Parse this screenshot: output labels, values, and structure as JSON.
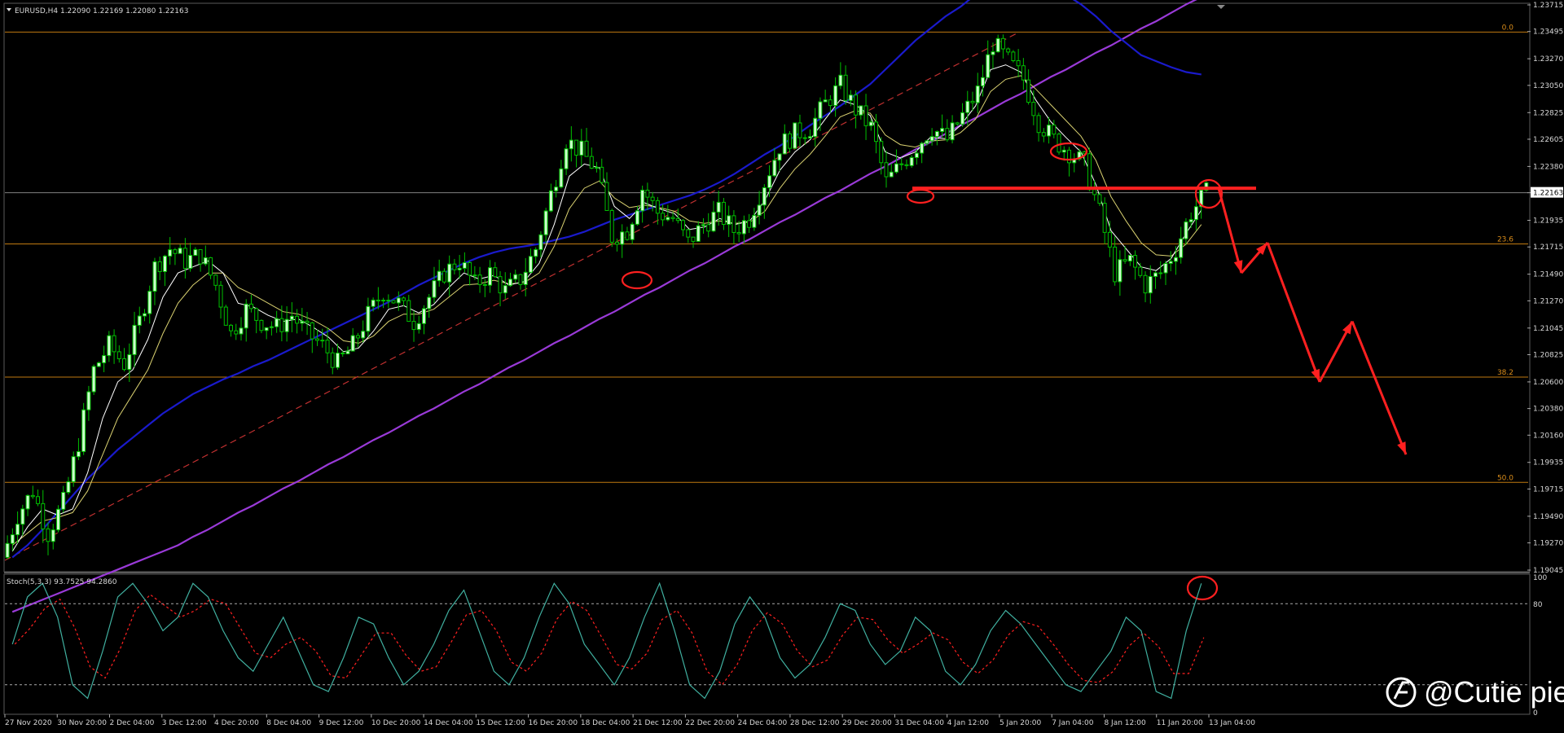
{
  "header": {
    "symbol_line": "EURUSD,H4  1.22090 1.22169 1.22080 1.22163",
    "stoch_line": "Stoch(5,3,3) 93.7525 94.2860"
  },
  "watermark": {
    "text": "@Cutie pie",
    "logo_icon": "logo-icon"
  },
  "colors": {
    "background": "#000000",
    "candle_up_body": "#ccffcc",
    "candle_wick": "#00c000",
    "ma_fast": "#ffffff",
    "ma_slow": "#d8d070",
    "ma_blue": "#1a1acc",
    "ma_purple": "#9a3ad8",
    "fib": "#c07a10",
    "annotation": "#ff2020",
    "stoch_main": "#40b0a0",
    "stoch_signal": "#ff2020"
  },
  "chart_data": [
    {
      "type": "candlestick",
      "symbol": "EURUSD",
      "timeframe": "H4",
      "ylim": [
        1.19045,
        1.23715
      ],
      "y_ticks": [
        "1.23715",
        "1.23495",
        "1.23270",
        "1.23050",
        "1.22825",
        "1.22605",
        "1.22380",
        "1.22163",
        "1.21935",
        "1.21715",
        "1.21490",
        "1.21270",
        "1.21045",
        "1.20825",
        "1.20600",
        "1.20380",
        "1.20160",
        "1.19935",
        "1.19715",
        "1.19490",
        "1.19270",
        "1.19045"
      ],
      "current_price": "1.22163",
      "x_ticks": [
        "27 Nov 2020",
        "30 Nov 20:00",
        "2 Dec 04:00",
        "3 Dec 12:00",
        "4 Dec 20:00",
        "8 Dec 04:00",
        "9 Dec 12:00",
        "10 Dec 20:00",
        "14 Dec 04:00",
        "15 Dec 12:00",
        "16 Dec 20:00",
        "18 Dec 04:00",
        "21 Dec 12:00",
        "22 Dec 20:00",
        "24 Dec 04:00",
        "28 Dec 12:00",
        "29 Dec 20:00",
        "31 Dec 04:00",
        "4 Jan 12:00",
        "5 Jan 20:00",
        "7 Jan 04:00",
        "8 Jan 12:00",
        "11 Jan 20:00",
        "13 Jan 04:00"
      ],
      "fib_levels": [
        {
          "label": "0.0",
          "price": 1.2349
        },
        {
          "label": "23.6",
          "price": 1.2174
        },
        {
          "label": "38.2",
          "price": 1.2064
        },
        {
          "label": "50.0",
          "price": 1.1977
        }
      ],
      "price_path": [
        1.1915,
        1.195,
        1.197,
        1.1935,
        1.196,
        1.201,
        1.207,
        1.209,
        1.2075,
        1.211,
        1.2155,
        1.217,
        1.216,
        1.2165,
        1.214,
        1.21,
        1.212,
        1.211,
        1.2105,
        1.2115,
        1.21,
        1.209,
        1.2075,
        1.209,
        1.2115,
        1.2135,
        1.2125,
        1.211,
        1.213,
        1.215,
        1.216,
        1.214,
        1.215,
        1.2135,
        1.2145,
        1.217,
        1.2215,
        1.226,
        1.225,
        1.2235,
        1.218,
        1.2185,
        1.222,
        1.22,
        1.2195,
        1.2175,
        1.219,
        1.22,
        1.2185,
        1.2195,
        1.2225,
        1.2255,
        1.2265,
        1.227,
        1.229,
        1.2305,
        1.2285,
        1.227,
        1.2225,
        1.224,
        1.2255,
        1.227,
        1.226,
        1.228,
        1.23,
        1.234,
        1.2325,
        1.231,
        1.2275,
        1.226,
        1.225,
        1.224,
        1.22,
        1.215,
        1.216,
        1.214,
        1.215,
        1.217,
        1.22,
        1.2216
      ],
      "ma_fast": [
        1.192,
        1.194,
        1.1955,
        1.195,
        1.1955,
        1.1985,
        1.203,
        1.206,
        1.207,
        1.2095,
        1.213,
        1.215,
        1.2155,
        1.216,
        1.215,
        1.2125,
        1.2122,
        1.2115,
        1.211,
        1.2112,
        1.2105,
        1.2097,
        1.2085,
        1.2088,
        1.2102,
        1.212,
        1.2123,
        1.2117,
        1.2124,
        1.2138,
        1.215,
        1.2145,
        1.2148,
        1.214,
        1.2143,
        1.2158,
        1.219,
        1.223,
        1.224,
        1.2237,
        1.2205,
        1.2195,
        1.2208,
        1.2203,
        1.2199,
        1.2186,
        1.2188,
        1.2195,
        1.219,
        1.2193,
        1.221,
        1.2235,
        1.225,
        1.226,
        1.2277,
        1.2293,
        1.2289,
        1.228,
        1.225,
        1.2245,
        1.225,
        1.2262,
        1.2261,
        1.2272,
        1.2288,
        1.2318,
        1.2322,
        1.2316,
        1.2293,
        1.2275,
        1.2262,
        1.225,
        1.2223,
        1.2185,
        1.217,
        1.2155,
        1.2152,
        1.2162,
        1.2183,
        1.2202
      ],
      "ma_slow": [
        1.1925,
        1.1935,
        1.1945,
        1.1948,
        1.1952,
        1.197,
        1.2,
        1.203,
        1.205,
        1.207,
        1.21,
        1.2125,
        1.214,
        1.215,
        1.215,
        1.2138,
        1.2132,
        1.2125,
        1.2118,
        1.2116,
        1.2111,
        1.2104,
        1.2094,
        1.2092,
        1.2098,
        1.211,
        1.2116,
        1.2116,
        1.212,
        1.213,
        1.214,
        1.2141,
        1.2144,
        1.2141,
        1.2142,
        1.215,
        1.2172,
        1.2203,
        1.222,
        1.2226,
        1.2212,
        1.2204,
        1.2206,
        1.2204,
        1.2201,
        1.2193,
        1.2191,
        1.2193,
        1.2191,
        1.2192,
        1.2201,
        1.222,
        1.2236,
        1.2248,
        1.2263,
        1.2279,
        1.2284,
        1.2282,
        1.2264,
        1.2256,
        1.2254,
        1.2259,
        1.226,
        1.2266,
        1.2277,
        1.23,
        1.231,
        1.2313,
        1.2302,
        1.2289,
        1.2276,
        1.2263,
        1.2243,
        1.2213,
        1.2193,
        1.2175,
        1.2165,
        1.2164,
        1.2174,
        1.219
      ],
      "ma_blue": [
        1.1915,
        1.1925,
        1.1938,
        1.1952,
        1.1966,
        1.198,
        1.1992,
        1.2004,
        1.2014,
        1.2024,
        1.2034,
        1.2042,
        1.205,
        1.2056,
        1.2062,
        1.2067,
        1.2073,
        1.2078,
        1.2084,
        1.209,
        1.2096,
        1.2102,
        1.2108,
        1.2114,
        1.212,
        1.2126,
        1.2133,
        1.214,
        1.2146,
        1.2152,
        1.2158,
        1.2163,
        1.2167,
        1.217,
        1.2172,
        1.2174,
        1.2177,
        1.218,
        1.2184,
        1.2189,
        1.2194,
        1.2198,
        1.2202,
        1.2206,
        1.221,
        1.2214,
        1.2219,
        1.2225,
        1.2232,
        1.224,
        1.2248,
        1.2255,
        1.2263,
        1.2272,
        1.228,
        1.2288,
        1.2297,
        1.2306,
        1.2318,
        1.233,
        1.2342,
        1.2352,
        1.2362,
        1.237,
        1.238,
        1.239,
        1.2395,
        1.2398,
        1.2395,
        1.2388,
        1.238,
        1.2372,
        1.2362,
        1.235,
        1.234,
        1.233,
        1.2325,
        1.232,
        1.2316,
        1.2314
      ],
      "ma_purple": [
        1.187,
        1.1875,
        1.188,
        1.1885,
        1.189,
        1.1895,
        1.19,
        1.1905,
        1.191,
        1.1915,
        1.192,
        1.1925,
        1.1932,
        1.1938,
        1.1945,
        1.1952,
        1.1958,
        1.1965,
        1.1972,
        1.1978,
        1.1985,
        1.1992,
        1.1998,
        1.2005,
        1.2012,
        1.2018,
        1.2025,
        1.2032,
        1.2038,
        1.2045,
        1.2052,
        1.2058,
        1.2065,
        1.2072,
        1.2078,
        1.2085,
        1.2092,
        1.2098,
        1.2105,
        1.2112,
        1.2118,
        1.2125,
        1.2132,
        1.2138,
        1.2145,
        1.2152,
        1.2158,
        1.2165,
        1.2172,
        1.2178,
        1.2185,
        1.2192,
        1.2198,
        1.2205,
        1.2212,
        1.2218,
        1.2225,
        1.2232,
        1.2238,
        1.2245,
        1.2252,
        1.2258,
        1.2265,
        1.2272,
        1.2278,
        1.2285,
        1.2292,
        1.2298,
        1.2305,
        1.2312,
        1.2318,
        1.2325,
        1.2332,
        1.2338,
        1.2345,
        1.2352,
        1.2358,
        1.2365,
        1.2372,
        1.2378
      ],
      "horizontal_line_price": 1.222,
      "projected_path": [
        1.222,
        1.215,
        1.2175,
        1.206,
        1.211,
        1.2
      ]
    },
    {
      "type": "line",
      "name": "Stoch(5,3,3)",
      "ylim": [
        0,
        100
      ],
      "levels": [
        20,
        80
      ],
      "y_ticks": [
        "100",
        "80",
        "0"
      ],
      "main": [
        50,
        85,
        95,
        70,
        20,
        10,
        45,
        85,
        95,
        80,
        60,
        70,
        95,
        85,
        60,
        40,
        30,
        50,
        70,
        45,
        20,
        15,
        40,
        70,
        65,
        40,
        20,
        30,
        50,
        75,
        90,
        60,
        30,
        20,
        40,
        70,
        95,
        80,
        50,
        35,
        20,
        40,
        70,
        95,
        60,
        20,
        10,
        30,
        65,
        85,
        70,
        40,
        25,
        35,
        55,
        80,
        75,
        50,
        35,
        45,
        70,
        60,
        30,
        20,
        35,
        60,
        75,
        65,
        50,
        35,
        20,
        15,
        30,
        45,
        70,
        60,
        15,
        10,
        60,
        95
      ]
    }
  ]
}
